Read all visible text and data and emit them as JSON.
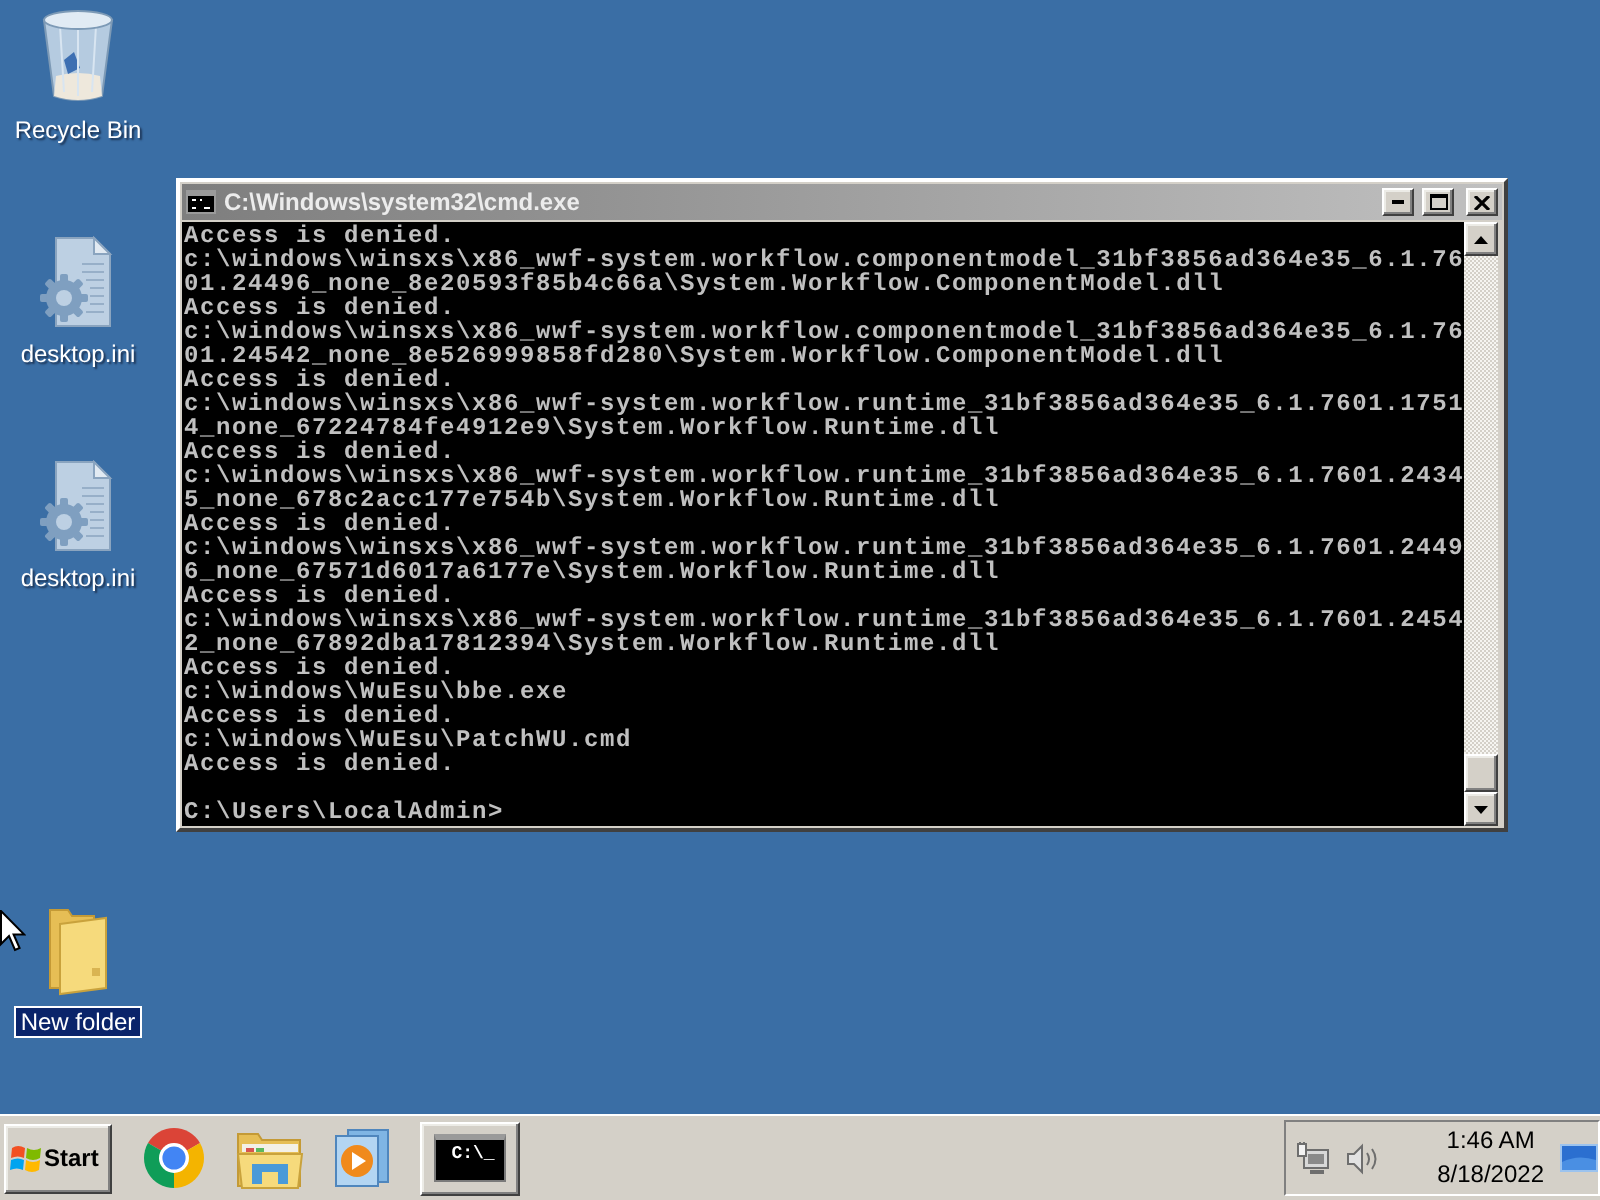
{
  "desktop": {
    "icons": [
      {
        "kind": "recycle-bin",
        "label": "Recycle Bin",
        "selected": false
      },
      {
        "kind": "settings-file",
        "label": "desktop.ini",
        "selected": false
      },
      {
        "kind": "settings-file",
        "label": "desktop.ini",
        "selected": false
      },
      {
        "kind": "folder",
        "label": "New folder",
        "selected": true
      }
    ]
  },
  "window": {
    "title": "C:\\Windows\\system32\\cmd.exe",
    "active": false,
    "console": {
      "lines": [
        "Access is denied.",
        "c:\\windows\\winsxs\\x86_wwf-system.workflow.componentmodel_31bf3856ad364e35_6.1.76",
        "01.24496_none_8e20593f85b4c66a\\System.Workflow.ComponentModel.dll",
        "Access is denied.",
        "c:\\windows\\winsxs\\x86_wwf-system.workflow.componentmodel_31bf3856ad364e35_6.1.76",
        "01.24542_none_8e526999858fd280\\System.Workflow.ComponentModel.dll",
        "Access is denied.",
        "c:\\windows\\winsxs\\x86_wwf-system.workflow.runtime_31bf3856ad364e35_6.1.7601.1751",
        "4_none_67224784fe4912e9\\System.Workflow.Runtime.dll",
        "Access is denied.",
        "c:\\windows\\winsxs\\x86_wwf-system.workflow.runtime_31bf3856ad364e35_6.1.7601.2434",
        "5_none_678c2acc177e754b\\System.Workflow.Runtime.dll",
        "Access is denied.",
        "c:\\windows\\winsxs\\x86_wwf-system.workflow.runtime_31bf3856ad364e35_6.1.7601.2449",
        "6_none_67571d6017a6177e\\System.Workflow.Runtime.dll",
        "Access is denied.",
        "c:\\windows\\winsxs\\x86_wwf-system.workflow.runtime_31bf3856ad364e35_6.1.7601.2454",
        "2_none_67892dba17812394\\System.Workflow.Runtime.dll",
        "Access is denied.",
        "c:\\windows\\WuEsu\\bbe.exe",
        "Access is denied.",
        "c:\\windows\\WuEsu\\PatchWU.cmd",
        "Access is denied."
      ],
      "prompt": "C:\\Users\\LocalAdmin>"
    }
  },
  "taskbar": {
    "start": {
      "label": "Start"
    },
    "quick_launch": [
      {
        "kind": "browser"
      },
      {
        "kind": "explorer"
      },
      {
        "kind": "media-player"
      }
    ],
    "windows": [
      {
        "kind": "console",
        "icon_text": "C:\\_"
      }
    ],
    "tray": {
      "time": "1:46 AM",
      "date": "8/18/2022"
    }
  }
}
